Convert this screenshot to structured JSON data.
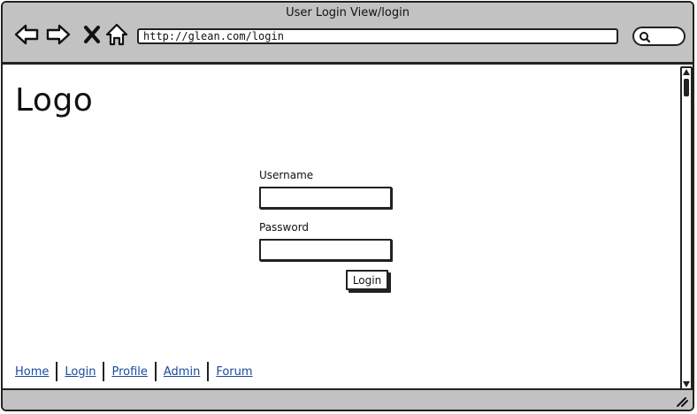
{
  "window": {
    "title": "User Login View/login"
  },
  "toolbar": {
    "back_icon": "arrow-left-icon",
    "forward_icon": "arrow-right-icon",
    "stop_icon": "close-icon",
    "home_icon": "home-icon",
    "search_icon": "search-icon"
  },
  "address": {
    "url": "http://glean.com/login"
  },
  "page": {
    "logo": "Logo"
  },
  "login_form": {
    "username_label": "Username",
    "username_value": "",
    "password_label": "Password",
    "password_value": "",
    "login_button": "Login"
  },
  "footer": {
    "links": [
      "Home",
      "Login",
      "Profile",
      "Admin",
      "Forum"
    ]
  },
  "colors": {
    "chrome": "#c2c2c2",
    "link": "#1a4aa0",
    "ink": "#222222"
  }
}
